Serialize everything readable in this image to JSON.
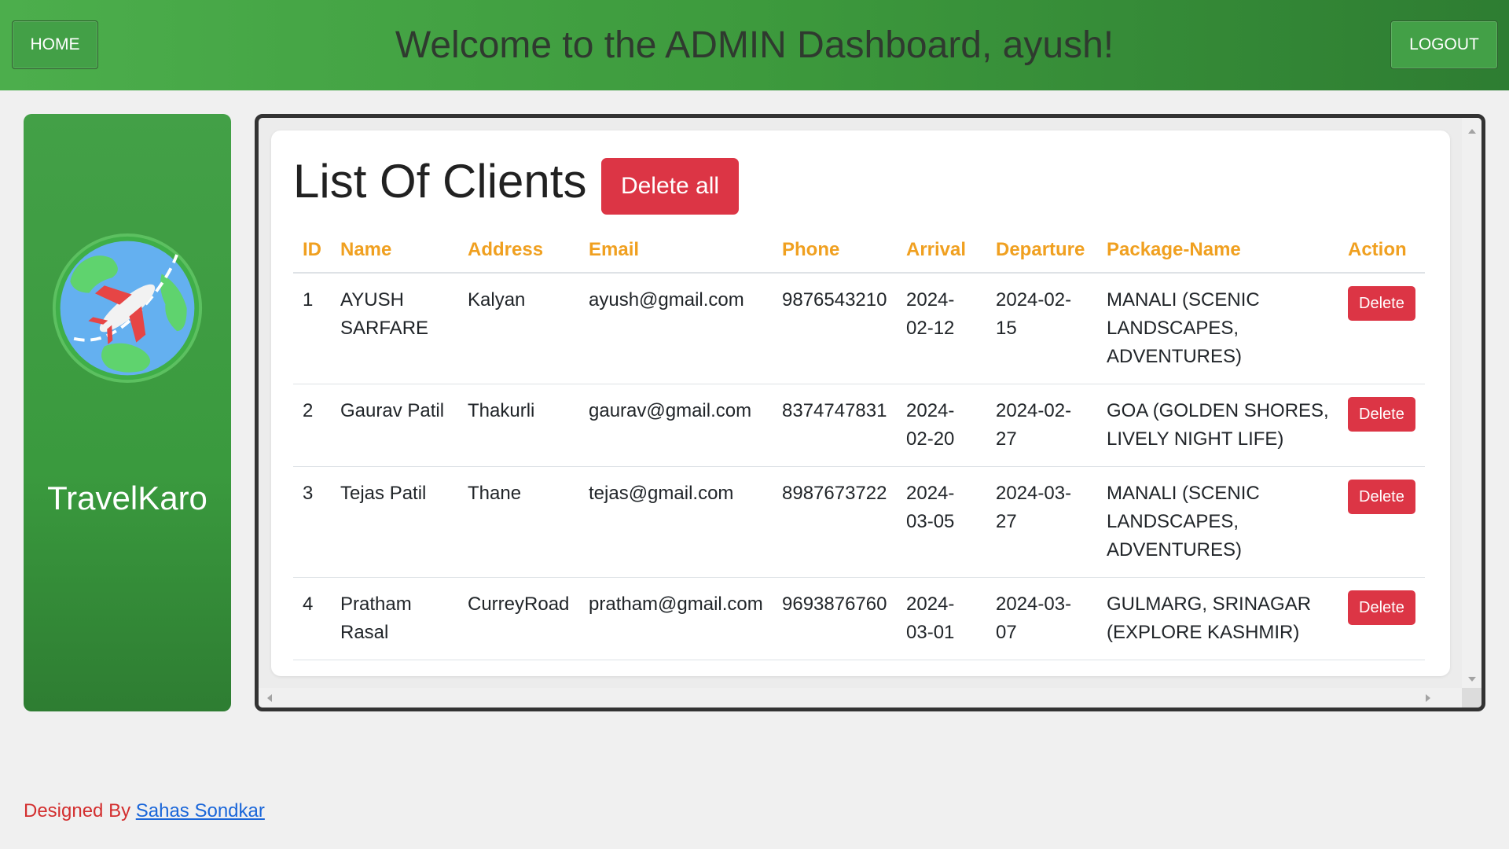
{
  "header": {
    "home_label": "HOME",
    "title": "Welcome to the ADMIN Dashboard, ayush!",
    "logout_label": "LOGOUT"
  },
  "sidebar": {
    "logo_icon": "globe-airplane-icon",
    "brand": "TravelKaro"
  },
  "main": {
    "title": "List Of Clients",
    "delete_all_label": "Delete all",
    "columns": [
      "ID",
      "Name",
      "Address",
      "Email",
      "Phone",
      "Arrival",
      "Departure",
      "Package-Name",
      "Action"
    ],
    "rows": [
      {
        "id": "1",
        "name": "AYUSH SARFARE",
        "address": "Kalyan",
        "email": "ayush@gmail.com",
        "phone": "9876543210",
        "arrival": "2024-02-12",
        "departure": "2024-02-15",
        "package": "MANALI (SCENIC LANDSCAPES, ADVENTURES)",
        "action": "Delete"
      },
      {
        "id": "2",
        "name": "Gaurav Patil",
        "address": "Thakurli",
        "email": "gaurav@gmail.com",
        "phone": "8374747831",
        "arrival": "2024-02-20",
        "departure": "2024-02-27",
        "package": "GOA (GOLDEN SHORES, LIVELY NIGHT LIFE)",
        "action": "Delete"
      },
      {
        "id": "3",
        "name": "Tejas Patil",
        "address": "Thane",
        "email": "tejas@gmail.com",
        "phone": "8987673722",
        "arrival": "2024-03-05",
        "departure": "2024-03-27",
        "package": "MANALI (SCENIC LANDSCAPES, ADVENTURES)",
        "action": "Delete"
      },
      {
        "id": "4",
        "name": "Pratham Rasal",
        "address": "CurreyRoad",
        "email": "pratham@gmail.com",
        "phone": "9693876760",
        "arrival": "2024-03-01",
        "departure": "2024-03-07",
        "package": "GULMARG, SRINAGAR (EXPLORE KASHMIR)",
        "action": "Delete"
      }
    ]
  },
  "footer": {
    "prefix": "Designed By ",
    "author": "Sahas Sondkar"
  },
  "colors": {
    "header_green": "#43a047",
    "danger": "#dc3545",
    "column_header": "#f0a020",
    "footer_text": "#d32f2f",
    "link": "#1a66d9"
  }
}
